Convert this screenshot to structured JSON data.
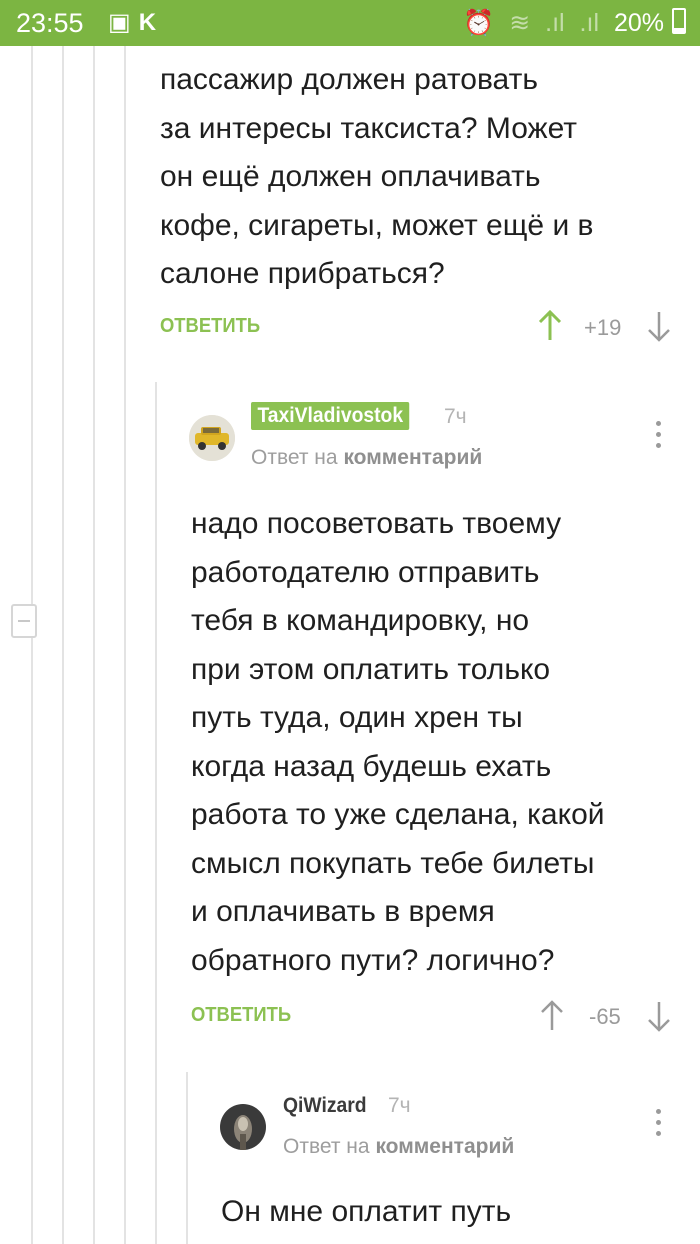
{
  "status_bar": {
    "time": "23:55",
    "left_icons": [
      "image-icon",
      "k-icon"
    ],
    "battery": "20%",
    "right_icons": [
      "alarm-icon",
      "wifi-icon",
      "signal-icon",
      "signal-icon",
      "battery-icon"
    ],
    "color": "#7cb542"
  },
  "comment1": {
    "text_lines": [
      "пассажир должен ратовать",
      "за интересы таксиста? Может",
      "он ещё должен оплачивать",
      "кофе, сигареты, может ещё и в",
      "салоне прибраться?"
    ],
    "reply_label": "ОТВЕТИТЬ",
    "rating": "+19",
    "upvoted": true
  },
  "comment2": {
    "author": "TaxiVladivostok",
    "author_is_op": true,
    "age": "7ч",
    "answer_prefix": "Ответ на",
    "answer_link": "комментарий",
    "text_lines": [
      "надо посоветовать твоему",
      "работодателю отправить",
      "тебя в командировку, но",
      "при этом оплатить только",
      "путь туда, один хрен ты",
      "когда назад будешь ехать",
      "работа то уже сделана, какой",
      "смысл покупать тебе билеты",
      "и оплачивать в время",
      "обратного пути? логично?"
    ],
    "reply_label": "ОТВЕТИТЬ",
    "rating": "-65"
  },
  "comment3": {
    "author": "QiWizard",
    "age": "7ч",
    "answer_prefix": "Ответ на",
    "answer_link": "комментарий",
    "text_lines": [
      "Он мне оплатит путь"
    ]
  },
  "colors": {
    "accent": "#8cc152",
    "muted": "#9a9a9a"
  }
}
